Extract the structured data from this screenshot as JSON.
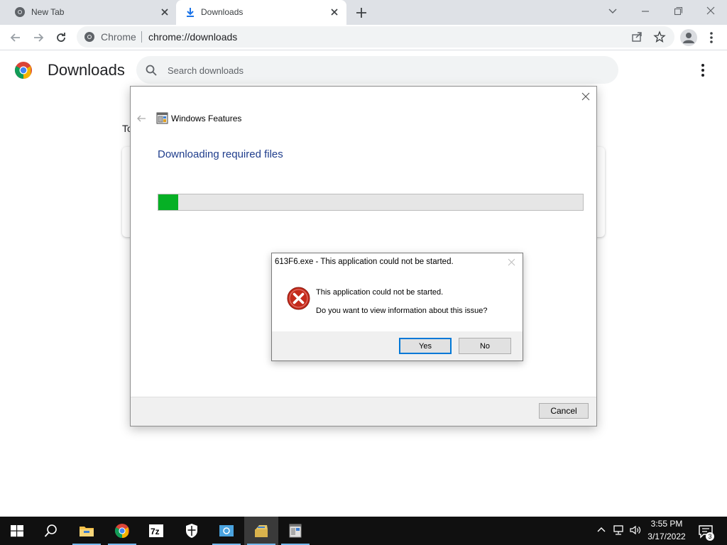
{
  "browser": {
    "tabs": [
      {
        "label": "New Tab",
        "icon": "chrome-icon",
        "active": false
      },
      {
        "label": "Downloads",
        "icon": "download-icon",
        "active": true
      }
    ],
    "omnibox": {
      "site": "Chrome",
      "url": "chrome://downloads"
    }
  },
  "page": {
    "title": "Downloads",
    "search_placeholder": "Search downloads",
    "section_label": "To"
  },
  "features_dialog": {
    "title": "Windows Features",
    "heading": "Downloading required files",
    "progress_fraction": 0.047,
    "cancel_label": "Cancel",
    "progress_color": "#06b025"
  },
  "error_dialog": {
    "title": "613F6.exe - This application could not be started.",
    "message_line1": "This application could not be started.",
    "message_line2": "Do you want to view information about this issue?",
    "yes_label": "Yes",
    "no_label": "No",
    "icon": "error-icon"
  },
  "taskbar": {
    "apps": [
      "start-icon",
      "search-icon",
      "file-explorer-icon",
      "chrome-icon",
      "7zip-icon",
      "security-icon",
      "control-panel-icon",
      "installer-icon",
      "windows-features-icon"
    ],
    "time": "3:55 PM",
    "date": "3/17/2022",
    "notification_count": "3"
  },
  "colors": {
    "accent_blue": "#1a73e8",
    "heading_blue": "#1f3d8c",
    "error_red": "#c42b1c"
  }
}
